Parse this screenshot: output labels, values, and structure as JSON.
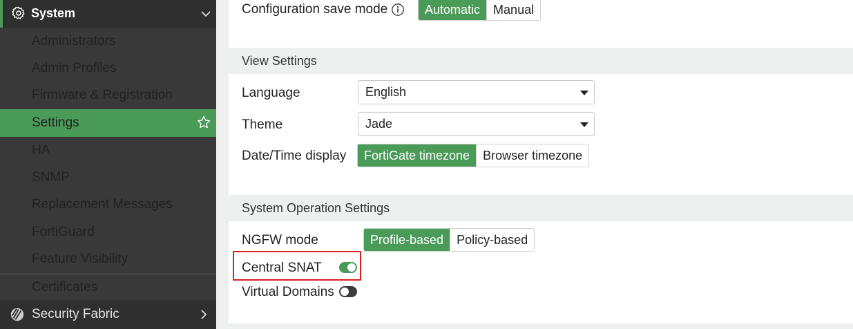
{
  "sidebar": {
    "header": {
      "title": "System",
      "icon": "gear-icon"
    },
    "items": [
      {
        "label": "Administrators"
      },
      {
        "label": "Admin Profiles"
      },
      {
        "label": "Firmware & Registration"
      },
      {
        "label": "Settings"
      },
      {
        "label": "HA"
      },
      {
        "label": "SNMP"
      },
      {
        "label": "Replacement Messages"
      },
      {
        "label": "FortiGuard"
      },
      {
        "label": "Feature Visibility"
      },
      {
        "label": "Certificates"
      }
    ],
    "active_item": "Settings",
    "footer": {
      "label": "Security Fabric",
      "icon": "security-fabric-icon"
    }
  },
  "main": {
    "config_save": {
      "label": "Configuration save mode",
      "options": [
        "Automatic",
        "Manual"
      ],
      "selected": "Automatic"
    },
    "view_settings": {
      "title": "View Settings",
      "language": {
        "label": "Language",
        "value": "English"
      },
      "theme": {
        "label": "Theme",
        "value": "Jade"
      },
      "datetime": {
        "label": "Date/Time display",
        "options": [
          "FortiGate timezone",
          "Browser timezone"
        ],
        "selected": "FortiGate timezone"
      }
    },
    "system_operation": {
      "title": "System Operation Settings",
      "ngfw": {
        "label": "NGFW mode",
        "options": [
          "Profile-based",
          "Policy-based"
        ],
        "selected": "Profile-based"
      },
      "central_snat": {
        "label": "Central SNAT",
        "enabled": true
      },
      "virtual_domains": {
        "label": "Virtual Domains",
        "enabled": false
      }
    }
  },
  "colors": {
    "accent": "#4a9a58",
    "sidebar_bg": "#393939",
    "highlight": "#d81e1e"
  }
}
